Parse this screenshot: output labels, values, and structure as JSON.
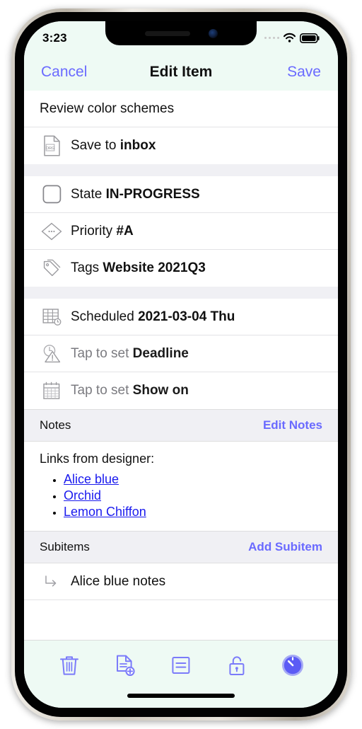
{
  "status_bar": {
    "time": "3:23",
    "wifi_icon": "wifi-icon",
    "battery_icon": "battery-full-icon",
    "signal_icon": "signal-dots-icon"
  },
  "navbar": {
    "cancel_label": "Cancel",
    "title": "Edit Item",
    "save_label": "Save"
  },
  "item": {
    "heading": "Review color schemes"
  },
  "file_row": {
    "icon": "org-document-icon",
    "prefix": "Save to ",
    "value": "inbox"
  },
  "properties": [
    {
      "icon": "checkbox-empty-icon",
      "prefix": "State ",
      "value": "IN-PROGRESS",
      "dim": false
    },
    {
      "icon": "priority-diamond-icon",
      "prefix": "Priority ",
      "value": "#A",
      "dim": false
    },
    {
      "icon": "tag-icon",
      "prefix": "Tags ",
      "value": "Website 2021Q3",
      "dim": false
    }
  ],
  "dates": [
    {
      "icon": "calendar-schedule-icon",
      "prefix": "Scheduled ",
      "value": "2021-03-04 Thu",
      "dim": false
    },
    {
      "icon": "deadline-warning-icon",
      "prefix": "Tap to set ",
      "value": "Deadline",
      "dim": true
    },
    {
      "icon": "calendar-icon",
      "prefix": "Tap to set ",
      "value": "Show on",
      "dim": true
    }
  ],
  "notes": {
    "section_title": "Notes",
    "action_label": "Edit Notes",
    "lead": "Links from designer:",
    "links": [
      "Alice blue",
      "Orchid",
      "Lemon Chiffon"
    ]
  },
  "subitems": {
    "section_title": "Subitems",
    "action_label": "Add Subitem",
    "items": [
      {
        "arrow_icon": "subitem-arrow-icon",
        "label": "Alice blue notes"
      }
    ]
  },
  "toolbar": {
    "buttons": [
      {
        "icon": "trash-icon",
        "name": "delete-button"
      },
      {
        "icon": "document-add-icon",
        "name": "new-document-button"
      },
      {
        "icon": "note-icon",
        "name": "notes-button"
      },
      {
        "icon": "unlock-icon",
        "name": "lock-button"
      },
      {
        "icon": "timer-icon",
        "name": "timer-button"
      }
    ]
  },
  "colors": {
    "accent": "#6a6aff",
    "link": "#1a1aee",
    "chrome_bg": "#eefaf4",
    "section_bg": "#f0f0f4"
  }
}
